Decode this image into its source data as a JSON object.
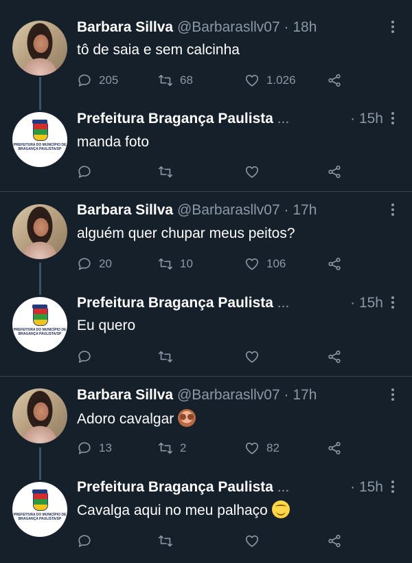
{
  "threads": [
    {
      "tweet": {
        "name": "Barbara Sillva",
        "handle": "@Barbarasllv07",
        "sep": "·",
        "time": "18h",
        "text": "tô de saia e sem calcinha",
        "emoji": "",
        "replies": "205",
        "retweets": "68",
        "likes": "1.026"
      },
      "reply": {
        "name": "Prefeitura Bragança Paulista",
        "ellipsis": "...",
        "time": "· 15h",
        "text": "manda foto",
        "emoji": "",
        "replies": "",
        "retweets": "",
        "likes": ""
      }
    },
    {
      "tweet": {
        "name": "Barbara Sillva",
        "handle": "@Barbarasllv07",
        "sep": "·",
        "time": "17h",
        "text": "alguém quer chupar meus peitos?",
        "emoji": "",
        "replies": "20",
        "retweets": "10",
        "likes": "106"
      },
      "reply": {
        "name": "Prefeitura Bragança Paulista",
        "ellipsis": "...",
        "time": "· 15h",
        "text": "Eu quero",
        "emoji": "",
        "replies": "",
        "retweets": "",
        "likes": ""
      }
    },
    {
      "tweet": {
        "name": "Barbara Sillva",
        "handle": "@Barbarasllv07",
        "sep": "·",
        "time": "17h",
        "text": "Adoro cavalgar",
        "emoji": "see-no-evil-monkey",
        "replies": "13",
        "retweets": "2",
        "likes": "82"
      },
      "reply": {
        "name": "Prefeitura Bragança Paulista",
        "ellipsis": "...",
        "time": "· 15h",
        "text": "Cavalga aqui no meu palhaço",
        "emoji": "relieved-face",
        "replies": "",
        "retweets": "",
        "likes": ""
      }
    }
  ],
  "logo_text": "PREFEITURA DO MUNICÍPIO DE BRAGANÇA PAULISTA/SP",
  "colors": {
    "background": "#15202b",
    "secondary_text": "#8b98a5",
    "divider": "#38444d"
  }
}
